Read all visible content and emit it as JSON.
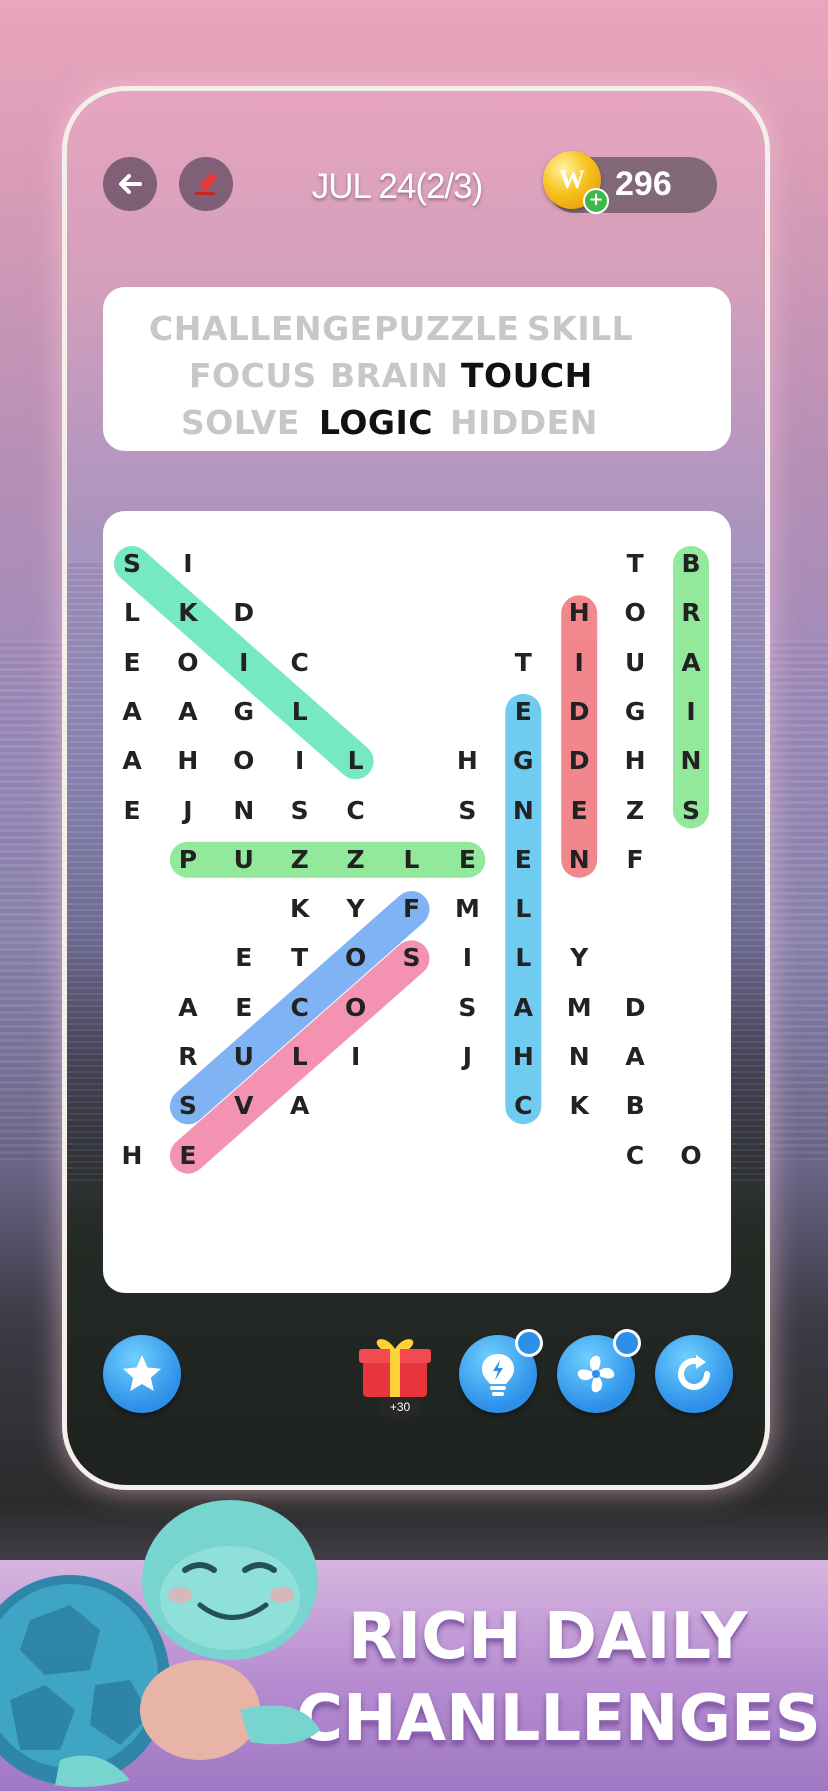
{
  "header": {
    "date_label": "JUL 24(2/3)",
    "coin_count": "296",
    "coin_letter": "W"
  },
  "word_list": {
    "rows": [
      [
        {
          "text": "CHALLENGE",
          "found": false
        },
        {
          "text": "PUZZLE",
          "found": false
        },
        {
          "text": "SKILL",
          "found": false
        }
      ],
      [
        {
          "text": "FOCUS",
          "found": false
        },
        {
          "text": "BRAIN",
          "found": false
        },
        {
          "text": "TOUCH",
          "found": true
        }
      ],
      [
        {
          "text": "SOLVE",
          "found": false
        },
        {
          "text": "LOGIC",
          "found": true
        },
        {
          "text": "HIDDEN",
          "found": false
        }
      ]
    ]
  },
  "grid": {
    "cols": 11,
    "rows": 13,
    "letters": [
      "S I . . . . . . . T B",
      "L K D . . . . . H O R",
      "E O I C . . . T I U A",
      "A A G L . . . E D G I",
      "A H O I L . H G D H N",
      "E J N S C . S N E Z S",
      ". P U Z Z L E E N F .",
      ". . . K Y F M L . . .",
      ". . E T O S I L Y . .",
      ". A E C O . S A M D .",
      ". R U L I . J H N A .",
      ". S V A . . . C K B .",
      "H E . . . . . . . C O"
    ],
    "highlights": [
      {
        "word": "SKILL",
        "color": "#5fe6b6",
        "from": [
          0,
          0
        ],
        "to": [
          4,
          4
        ]
      },
      {
        "word": "PUZZLE",
        "color": "#7fe58a",
        "from": [
          6,
          1
        ],
        "to": [
          6,
          6
        ]
      },
      {
        "word": "BRAINS",
        "color": "#7fe58a",
        "from": [
          0,
          10
        ],
        "to": [
          5,
          10
        ]
      },
      {
        "word": "HIDDEN",
        "color": "#f0727a",
        "from": [
          1,
          8
        ],
        "to": [
          6,
          8
        ]
      },
      {
        "word": "CHALLENGE",
        "color": "#56c3ee",
        "from": [
          11,
          7
        ],
        "to": [
          3,
          7
        ]
      },
      {
        "word": "FOCUS",
        "color": "#6aa6f2",
        "from": [
          7,
          5
        ],
        "to": [
          11,
          1
        ]
      },
      {
        "word": "SOLVE",
        "color": "#f37fa5",
        "from": [
          8,
          5
        ],
        "to": [
          12,
          1
        ]
      }
    ]
  },
  "bottom_bar": {
    "gift_reward": "+30",
    "buttons": [
      "star",
      "hint-bulb",
      "fan",
      "refresh"
    ]
  },
  "promo": {
    "line1": "RICH DAILY",
    "line2": "CHANLLENGES"
  },
  "colors": {
    "accent_blue": "#2d8fe8",
    "found_word": "#111111",
    "unfound_word": "#c7c7c7"
  }
}
